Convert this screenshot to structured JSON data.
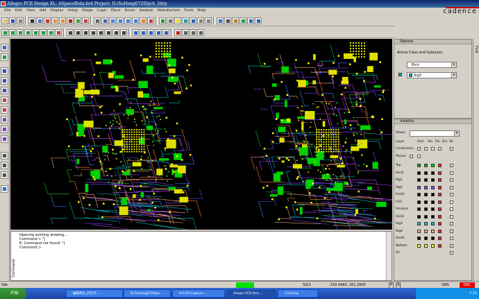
{
  "title": "Allegro PCB Design XL: ASpaceBrda.brd  Project: D:/SuHong0720/pcb_2drp",
  "brand": "cadence",
  "menu": [
    "File",
    "Edit",
    "View",
    "Add",
    "Display",
    "Setup",
    "Shape",
    "Logic",
    "Place",
    "Route",
    "Analyze",
    "Manufacture",
    "Tools",
    "Help"
  ],
  "options": {
    "header": "Options",
    "active_label": "Active Class and Subclass:",
    "class_value": "Etch",
    "subclass_value": "Sig3"
  },
  "visibility": {
    "header": "Visibility",
    "views_label": "Views:",
    "col_layer": "Layer",
    "col_etch": "Etch",
    "col_via": "Via",
    "col_pin": "Pin",
    "col_drc": "Drc",
    "col_all": "All",
    "conductors": "Conductors",
    "planes": "Planes",
    "layers": [
      {
        "name": "Top",
        "c": [
          "#00b000",
          "#00c000",
          "#00d000",
          "#ff2020"
        ],
        "all": true
      },
      {
        "name": "Gnd1",
        "c": [
          "#000000",
          "#000000",
          "#000000",
          "#ff2020"
        ],
        "all": false
      },
      {
        "name": "Sig1",
        "c": [
          "#000000",
          "#000000",
          "#000000",
          "#ff2020"
        ],
        "all": true
      },
      {
        "name": "Sig2",
        "c": [
          "#8040ff",
          "#8040ff",
          "#8040ff",
          "#ff2020"
        ],
        "all": true
      },
      {
        "name": "Gnd2",
        "c": [
          "#000000",
          "#000000",
          "#000000",
          "#ff2020"
        ],
        "all": false
      },
      {
        "name": "V33",
        "c": [
          "#000000",
          "#000000",
          "#000000",
          "#ff2020"
        ],
        "all": false
      },
      {
        "name": "Vmulvin",
        "c": [
          "#000000",
          "#000000",
          "#000000",
          "#ff2020"
        ],
        "all": false
      },
      {
        "name": "Gnd3",
        "c": [
          "#000000",
          "#000000",
          "#000000",
          "#ff2020"
        ],
        "all": false
      },
      {
        "name": "Sig3",
        "c": [
          "#00c0c0",
          "#00c0c0",
          "#00c0c0",
          "#ff2020"
        ],
        "all": true
      },
      {
        "name": "Sig4",
        "c": [
          "#ffb080",
          "#ffb080",
          "#ffb080",
          "#ff2020"
        ],
        "all": true
      },
      {
        "name": "Gnd4",
        "c": [
          "#000000",
          "#000000",
          "#000000",
          "#ff2020"
        ],
        "all": false
      },
      {
        "name": "Bottom",
        "c": [
          "#ffff00",
          "#ffff00",
          "#ffff00",
          "#ff2020"
        ],
        "all": true
      },
      {
        "name": "All",
        "c": [],
        "all": true
      }
    ]
  },
  "find_tab": "Find",
  "command": {
    "label": "Command",
    "lines": [
      "Opening existing drawing...",
      "Command > \"[",
      "E- Command not found: \"]",
      "Command >"
    ]
  },
  "status": {
    "mode": "Idle",
    "layer": "SIG3",
    "coords": "-150.4980, 161.2900",
    "p": "P",
    "a": "A",
    "sel": "GEN",
    "drc": "DRC"
  },
  "taskbar": {
    "start": "开始",
    "tasks": [
      "编辑博文_药交子...",
      "D:\\SuHong0720\\pc...",
      "OrCAD Capture -...",
      "Allegro PCB Desi...",
      "V3.trcInp"
    ],
    "time": "7:15"
  },
  "colors": {
    "canvas": "#000000",
    "title_start": "#0a246a",
    "title_end": "#3a6ea5"
  }
}
